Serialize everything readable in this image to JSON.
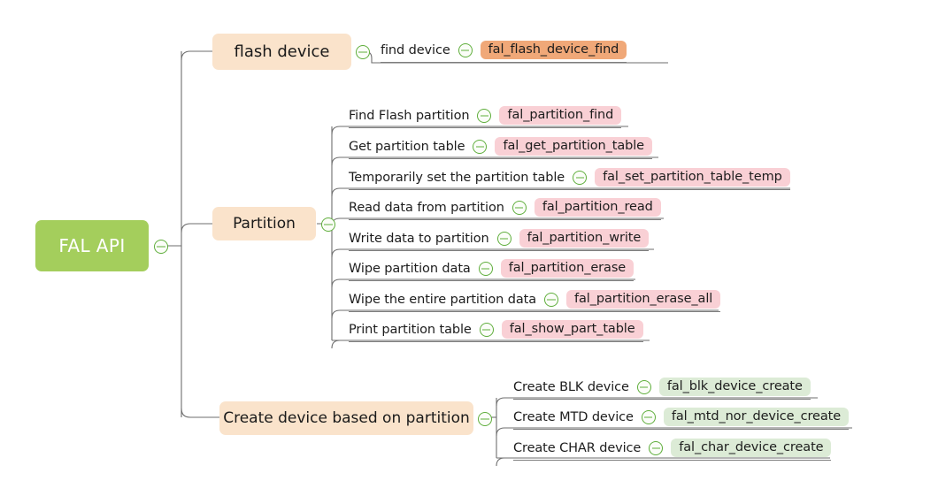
{
  "diagram": {
    "type": "mindmap",
    "root": {
      "label": "FAL API",
      "color": "#a4ce5c",
      "text_color": "#ffffff"
    },
    "branches": [
      {
        "label": "flash device",
        "color": "#fae3cb",
        "badge_color": "#f0a878",
        "children": [
          {
            "label": "find device",
            "api": "fal_flash_device_find"
          }
        ]
      },
      {
        "label": "Partition",
        "color": "#fae3cb",
        "badge_color": "#f9d0d5",
        "children": [
          {
            "label": "Find Flash partition",
            "api": "fal_partition_find"
          },
          {
            "label": "Get partition table",
            "api": "fal_get_partition_table"
          },
          {
            "label": "Temporarily set the partition table",
            "api": "fal_set_partition_table_temp"
          },
          {
            "label": "Read data from partition",
            "api": "fal_partition_read"
          },
          {
            "label": "Write data to partition",
            "api": "fal_partition_write"
          },
          {
            "label": "Wipe partition data",
            "api": "fal_partition_erase"
          },
          {
            "label": "Wipe the entire partition data",
            "api": "fal_partition_erase_all"
          },
          {
            "label": "Print partition table",
            "api": "fal_show_part_table"
          }
        ]
      },
      {
        "label": "Create device based on partition",
        "color": "#fae3cb",
        "badge_color": "#dcebd6",
        "children": [
          {
            "label": "Create BLK device",
            "api": "fal_blk_device_create"
          },
          {
            "label": "Create MTD device",
            "api": "fal_mtd_nor_device_create"
          },
          {
            "label": "Create CHAR device",
            "api": "fal_char_device_create"
          }
        ]
      }
    ],
    "toggle_icon": "collapse-minus-circle-icon",
    "connector_color": "#6e6e6e",
    "background": "#ffffff"
  }
}
